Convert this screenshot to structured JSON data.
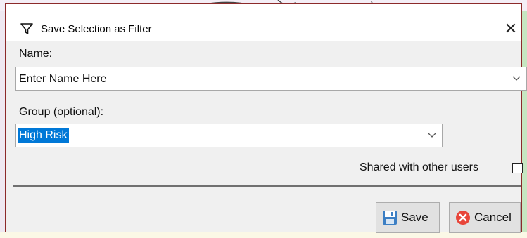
{
  "dialog": {
    "title": "Save Selection as Filter",
    "title_icon": "filter-icon",
    "close_glyph": "✕"
  },
  "form": {
    "name_label": "Name:",
    "name_value": "Enter Name Here",
    "group_label": "Group (optional):",
    "group_value": "High Risk",
    "shared_label": "Shared with other users",
    "shared_checked": false
  },
  "buttons": {
    "save_label": "Save",
    "save_icon": "floppy-disk-icon",
    "cancel_label": "Cancel",
    "cancel_icon": "cancel-circle-icon"
  },
  "colors": {
    "selection": "#0078d7",
    "dialog_border": "#8c2a2a",
    "cancel_red": "#e8463a"
  }
}
